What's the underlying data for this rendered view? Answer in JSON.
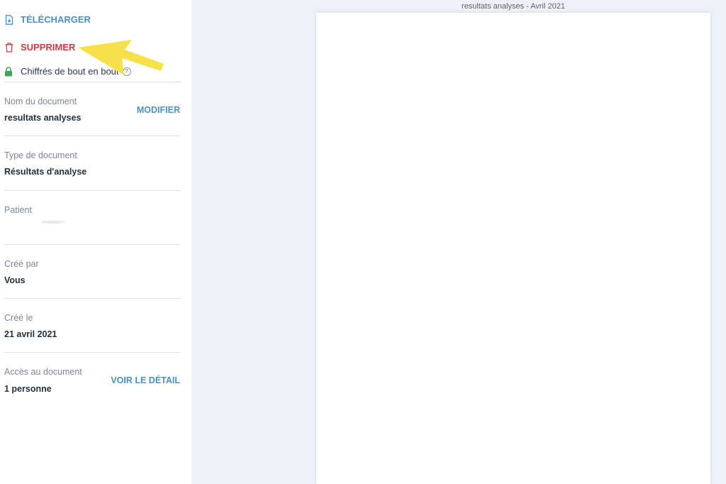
{
  "actions": {
    "download_label": "TÉLÉCHARGER",
    "delete_label": "SUPPRIMER",
    "encryption_label": "Chiffrés de bout en bout",
    "help_glyph": "?"
  },
  "fields": {
    "document_name": {
      "label": "Nom du document",
      "value": "resultats analyses",
      "action": "MODIFIER"
    },
    "document_type": {
      "label": "Type de document",
      "value": "Résultats d'analyse"
    },
    "patient": {
      "label": "Patient"
    },
    "created_by": {
      "label": "Créé par",
      "value": "Vous"
    },
    "created_on": {
      "label": "Créé le",
      "value": "21 avril 2021"
    },
    "access": {
      "label": "Accès au document",
      "value": "1 personne",
      "action": "VOIR LE DÉTAIL"
    }
  },
  "viewer": {
    "title": "resultats analyses - Avril 2021"
  },
  "colors": {
    "link": "#4a90c8",
    "danger": "#d0393f",
    "lock": "#3fa55b",
    "annotation_arrow": "#f7e14a"
  },
  "icons": {
    "download": "download-file-icon",
    "delete": "trash-icon",
    "encryption": "lock-icon",
    "help": "help-circle-icon",
    "annotation": "annotation-arrow-icon"
  }
}
